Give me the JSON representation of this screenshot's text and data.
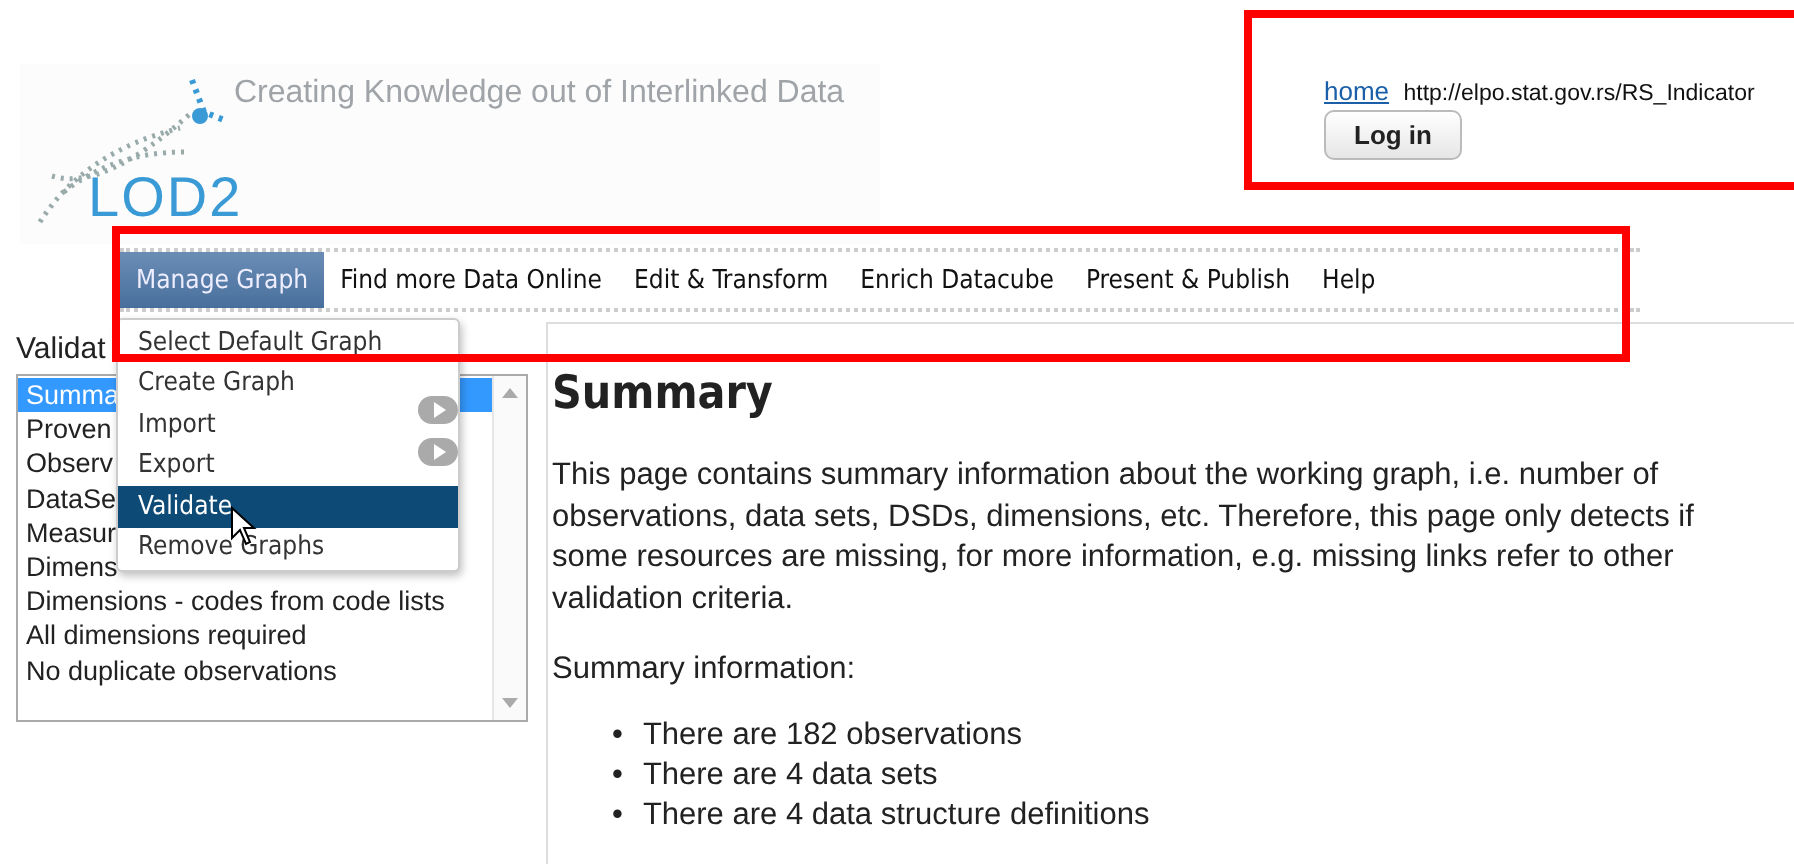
{
  "header": {
    "tagline": "Creating Knowledge out of Interlinked Data",
    "logo_text": "LOD2"
  },
  "account": {
    "home_link": "home",
    "url": "http://elpo.stat.gov.rs/RS_Indicator",
    "login_button": "Log in"
  },
  "menu": [
    {
      "label": "Manage Graph",
      "selected": true
    },
    {
      "label": "Find more Data Online",
      "selected": false
    },
    {
      "label": "Edit & Transform",
      "selected": false
    },
    {
      "label": "Enrich Datacube",
      "selected": false
    },
    {
      "label": "Present & Publish",
      "selected": false
    },
    {
      "label": "Help",
      "selected": false
    }
  ],
  "dropdown": [
    {
      "label": "Select Default Graph",
      "submenu": false,
      "selected": false
    },
    {
      "label": "Create Graph",
      "submenu": false,
      "selected": false
    },
    {
      "label": "Import",
      "submenu": true,
      "selected": false
    },
    {
      "label": "Export",
      "submenu": true,
      "selected": false
    },
    {
      "label": "Validate",
      "submenu": false,
      "selected": true
    },
    {
      "label": "Remove Graphs",
      "submenu": false,
      "selected": false
    }
  ],
  "validation": {
    "label": "Validat",
    "items": [
      {
        "label": "Summa",
        "selected": true
      },
      {
        "label": "Proven",
        "selected": false
      },
      {
        "label": "Observ",
        "selected": false
      },
      {
        "label": "DataSe",
        "selected": false
      },
      {
        "label": "Measur",
        "selected": false
      },
      {
        "label": "Dimens",
        "selected": false
      },
      {
        "label": "Dimensions - codes from code lists",
        "selected": false
      },
      {
        "label": "All dimensions required",
        "selected": false
      },
      {
        "label": "No duplicate observations",
        "selected": false
      }
    ]
  },
  "content": {
    "title": "Summary",
    "intro": "This page contains summary information about the working graph, i.e. number of observations, data sets, DSDs, dimensions, etc. Therefore, this page only detects if some resources are missing, for more information, e.g. missing links refer to other validation criteria.",
    "subheading": "Summary information:",
    "bullets": [
      {
        "marker": "•",
        "text": "There are 182 observations"
      },
      {
        "marker": "•",
        "text": "There are 4 data sets"
      },
      {
        "marker": "•",
        "text": "There are 4 data structure definitions"
      }
    ]
  }
}
